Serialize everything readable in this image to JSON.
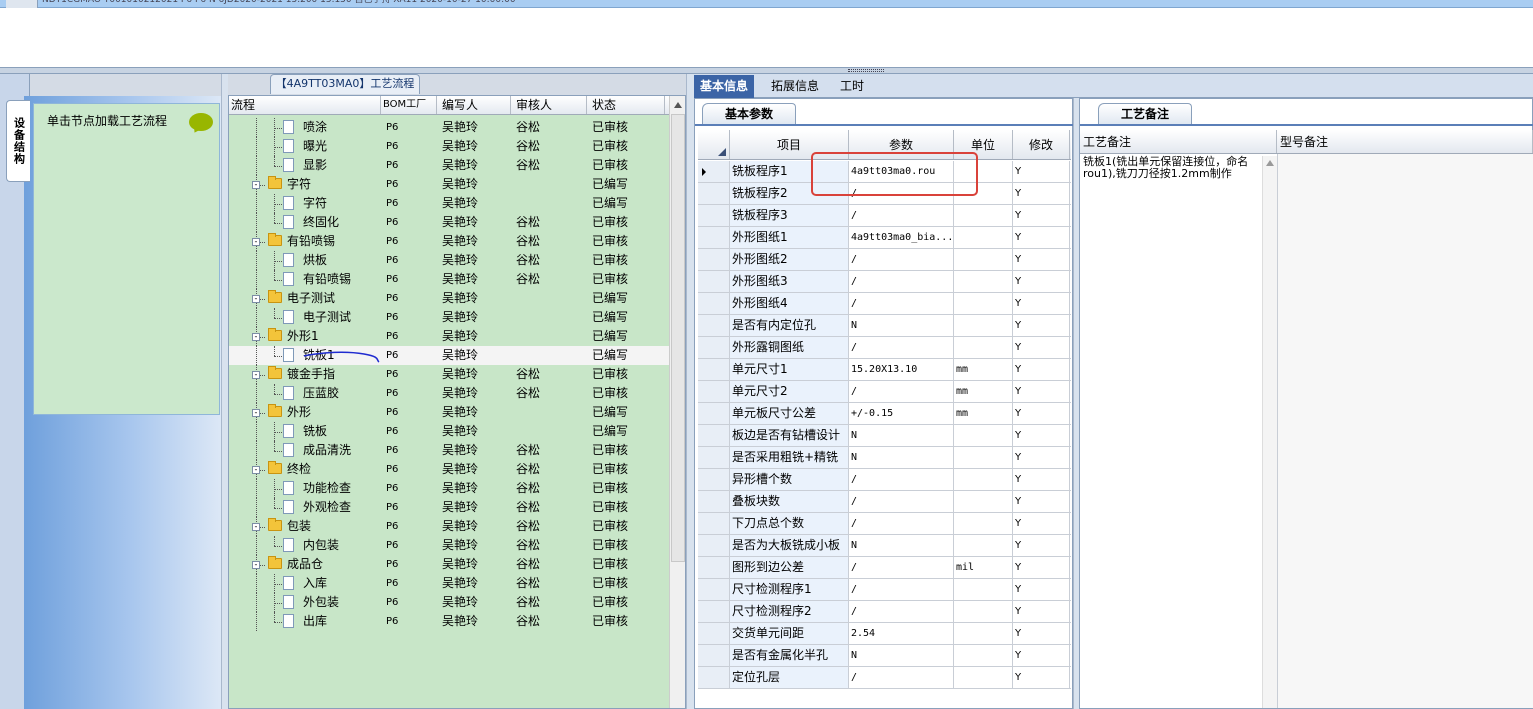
{
  "top_grid": {
    "visible_row_fragment": "NDT1CGMAO  T001010212021   P6   P6   N   6JD2020-2021   15.200   15.150   自己手持   XA11   2020-10-27 10:00:00"
  },
  "left_panel": {
    "vertical_tab": "设备结构",
    "load_hint": "单击节点加载工艺流程"
  },
  "tree_panel": {
    "title": "【4A9TT03MA0】工艺流程",
    "columns": [
      "流程",
      "BOM工厂",
      "编写人",
      "审核人",
      "状态"
    ],
    "rows": [
      {
        "name": "喷涂",
        "level": 2,
        "bom": "P6",
        "writer": "吴艳玲",
        "reviewer": "谷松",
        "status": "已审核"
      },
      {
        "name": "曝光",
        "level": 2,
        "bom": "P6",
        "writer": "吴艳玲",
        "reviewer": "谷松",
        "status": "已审核"
      },
      {
        "name": "显影",
        "level": 2,
        "bom": "P6",
        "writer": "吴艳玲",
        "reviewer": "谷松",
        "status": "已审核"
      },
      {
        "name": "字符",
        "level": 1,
        "bom": "P6",
        "writer": "吴艳玲",
        "reviewer": "",
        "status": "已编写"
      },
      {
        "name": "字符",
        "level": 2,
        "bom": "P6",
        "writer": "吴艳玲",
        "reviewer": "",
        "status": "已编写"
      },
      {
        "name": "终固化",
        "level": 2,
        "bom": "P6",
        "writer": "吴艳玲",
        "reviewer": "谷松",
        "status": "已审核"
      },
      {
        "name": "有铅喷锡",
        "level": 1,
        "bom": "P6",
        "writer": "吴艳玲",
        "reviewer": "谷松",
        "status": "已审核"
      },
      {
        "name": "烘板",
        "level": 2,
        "bom": "P6",
        "writer": "吴艳玲",
        "reviewer": "谷松",
        "status": "已审核"
      },
      {
        "name": "有铅喷锡",
        "level": 2,
        "bom": "P6",
        "writer": "吴艳玲",
        "reviewer": "谷松",
        "status": "已审核"
      },
      {
        "name": "电子测试",
        "level": 1,
        "bom": "P6",
        "writer": "吴艳玲",
        "reviewer": "",
        "status": "已编写"
      },
      {
        "name": "电子测试",
        "level": 2,
        "bom": "P6",
        "writer": "吴艳玲",
        "reviewer": "",
        "status": "已编写"
      },
      {
        "name": "外形1",
        "level": 1,
        "bom": "P6",
        "writer": "吴艳玲",
        "reviewer": "",
        "status": "已编写"
      },
      {
        "name": "铣板1",
        "level": 2,
        "bom": "P6",
        "writer": "吴艳玲",
        "reviewer": "",
        "status": "已编写",
        "selected": true
      },
      {
        "name": "镀金手指",
        "level": 1,
        "bom": "P6",
        "writer": "吴艳玲",
        "reviewer": "谷松",
        "status": "已审核"
      },
      {
        "name": "压蓝胶",
        "level": 2,
        "bom": "P6",
        "writer": "吴艳玲",
        "reviewer": "谷松",
        "status": "已审核"
      },
      {
        "name": "外形",
        "level": 1,
        "bom": "P6",
        "writer": "吴艳玲",
        "reviewer": "",
        "status": "已编写"
      },
      {
        "name": "铣板",
        "level": 2,
        "bom": "P6",
        "writer": "吴艳玲",
        "reviewer": "",
        "status": "已编写"
      },
      {
        "name": "成品清洗",
        "level": 2,
        "bom": "P6",
        "writer": "吴艳玲",
        "reviewer": "谷松",
        "status": "已审核"
      },
      {
        "name": "终检",
        "level": 1,
        "bom": "P6",
        "writer": "吴艳玲",
        "reviewer": "谷松",
        "status": "已审核"
      },
      {
        "name": "功能检查",
        "level": 2,
        "bom": "P6",
        "writer": "吴艳玲",
        "reviewer": "谷松",
        "status": "已审核"
      },
      {
        "name": "外观检查",
        "level": 2,
        "bom": "P6",
        "writer": "吴艳玲",
        "reviewer": "谷松",
        "status": "已审核"
      },
      {
        "name": "包装",
        "level": 1,
        "bom": "P6",
        "writer": "吴艳玲",
        "reviewer": "谷松",
        "status": "已审核"
      },
      {
        "name": "内包装",
        "level": 2,
        "bom": "P6",
        "writer": "吴艳玲",
        "reviewer": "谷松",
        "status": "已审核"
      },
      {
        "name": "成品仓",
        "level": 1,
        "bom": "P6",
        "writer": "吴艳玲",
        "reviewer": "谷松",
        "status": "已审核"
      },
      {
        "name": "入库",
        "level": 2,
        "bom": "P6",
        "writer": "吴艳玲",
        "reviewer": "谷松",
        "status": "已审核"
      },
      {
        "name": "外包装",
        "level": 2,
        "bom": "P6",
        "writer": "吴艳玲",
        "reviewer": "谷松",
        "status": "已审核"
      },
      {
        "name": "出库",
        "level": 2,
        "bom": "P6",
        "writer": "吴艳玲",
        "reviewer": "谷松",
        "status": "已审核"
      }
    ]
  },
  "right_tabs": [
    "基本信息",
    "拓展信息",
    "工时"
  ],
  "basic_params": {
    "tab_label": "基本参数",
    "columns": [
      "项目",
      "参数",
      "单位",
      "修改"
    ],
    "rows": [
      {
        "item": "铣板程序1",
        "value": "4a9tt03ma0.rou",
        "unit": "",
        "mod": "Y",
        "current": true
      },
      {
        "item": "铣板程序2",
        "value": "/",
        "unit": "",
        "mod": "Y"
      },
      {
        "item": "铣板程序3",
        "value": "/",
        "unit": "",
        "mod": "Y"
      },
      {
        "item": "外形图纸1",
        "value": "4a9tt03ma0_bia...",
        "unit": "",
        "mod": "Y"
      },
      {
        "item": "外形图纸2",
        "value": "/",
        "unit": "",
        "mod": "Y"
      },
      {
        "item": "外形图纸3",
        "value": "/",
        "unit": "",
        "mod": "Y"
      },
      {
        "item": "外形图纸4",
        "value": "/",
        "unit": "",
        "mod": "Y"
      },
      {
        "item": "是否有内定位孔",
        "value": "N",
        "unit": "",
        "mod": "Y"
      },
      {
        "item": "外形露铜图纸",
        "value": "/",
        "unit": "",
        "mod": "Y"
      },
      {
        "item": "单元尺寸1",
        "value": "15.20X13.10",
        "unit": "mm",
        "mod": "Y"
      },
      {
        "item": "单元尺寸2",
        "value": "/",
        "unit": "mm",
        "mod": "Y"
      },
      {
        "item": "单元板尺寸公差",
        "value": "+/-0.15",
        "unit": "mm",
        "mod": "Y"
      },
      {
        "item": "板边是否有钻槽设计",
        "value": "N",
        "unit": "",
        "mod": "Y"
      },
      {
        "item": "是否采用粗铣+精铣",
        "value": "N",
        "unit": "",
        "mod": "Y"
      },
      {
        "item": "异形槽个数",
        "value": "/",
        "unit": "",
        "mod": "Y"
      },
      {
        "item": "叠板块数",
        "value": "/",
        "unit": "",
        "mod": "Y"
      },
      {
        "item": "下刀点总个数",
        "value": "/",
        "unit": "",
        "mod": "Y"
      },
      {
        "item": "是否为大板铣成小板",
        "value": "N",
        "unit": "",
        "mod": "Y"
      },
      {
        "item": "图形到边公差",
        "value": "/",
        "unit": "mil",
        "mod": "Y"
      },
      {
        "item": "尺寸检测程序1",
        "value": "/",
        "unit": "",
        "mod": "Y"
      },
      {
        "item": "尺寸检测程序2",
        "value": "/",
        "unit": "",
        "mod": "Y"
      },
      {
        "item": "交货单元间距",
        "value": "2.54",
        "unit": "",
        "mod": "Y"
      },
      {
        "item": "是否有金属化半孔",
        "value": "N",
        "unit": "",
        "mod": "Y"
      },
      {
        "item": "定位孔层",
        "value": "/",
        "unit": "",
        "mod": "Y"
      }
    ]
  },
  "craft_notes": {
    "tab_label": "工艺备注",
    "columns": [
      "工艺备注",
      "型号备注"
    ],
    "note": "铣板1(铣出单元保留连接位，命名rou1),铣刀刀径按1.2mm制作",
    "model_note": ""
  },
  "colors": {
    "tree_bg": "#c8e6c8",
    "active_tab": "#3b64a6",
    "highlight_box": "#d9423a",
    "annotation_line": "#1f2bd0"
  }
}
